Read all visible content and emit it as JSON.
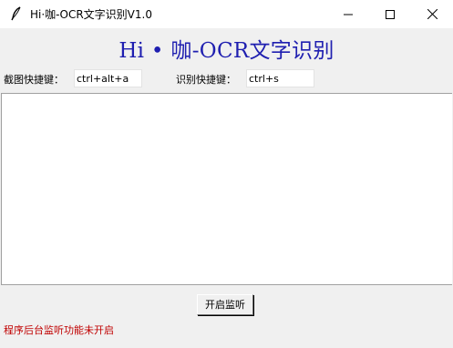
{
  "window": {
    "title": "Hi·咖-OCR文字识别V1.0",
    "controls": {
      "minimize_icon": "minimize-icon",
      "maximize_icon": "maximize-icon",
      "close_icon": "close-icon"
    }
  },
  "main": {
    "heading": "Hi • 咖-OCR文字识别",
    "capture_hotkey": {
      "label": "截图快捷键：",
      "value": "ctrl+alt+a"
    },
    "recognize_hotkey": {
      "label": "识别快捷键：",
      "value": "ctrl+s"
    },
    "result_text": "",
    "start_button_label": "开启监听",
    "status": "程序后台监听功能未开启"
  },
  "colors": {
    "heading": "#1f1fb0",
    "status": "#c00000",
    "background": "#f0f0f0"
  }
}
